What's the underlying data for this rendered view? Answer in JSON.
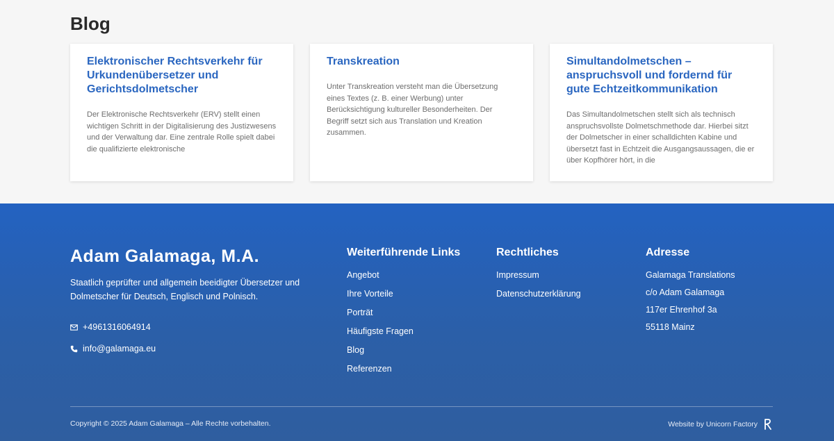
{
  "blog": {
    "heading": "Blog",
    "cards": [
      {
        "title": "Elektronischer Rechtsverkehr für Urkundenübersetzer und Gerichtsdolmetscher",
        "excerpt": "Der Elektronische Rechtsverkehr (ERV) stellt einen wichtigen Schritt in der Digitalisierung des Justizwesens und der Verwaltung dar. Eine zentrale Rolle spielt dabei die qualifizierte elektronische"
      },
      {
        "title": "Transkreation",
        "excerpt": "Unter Transkreation versteht man die Übersetzung eines Textes (z. B. einer Werbung) unter Berücksichtigung kultureller Besonderheiten. Der Begriff setzt sich aus Translation und Kreation zusammen."
      },
      {
        "title": "Simultandolmetschen – anspruchsvoll und fordernd für gute Echtzeitkommunikation",
        "excerpt": "Das Simultandolmetschen stellt sich als technisch anspruchsvollste Dolmetschmethode dar. Hierbei sitzt der Dolmetscher in einer schalldichten Kabine und übersetzt fast in Echtzeit die Ausgangsaussagen, die er über Kopfhörer hört, in die"
      }
    ]
  },
  "footer": {
    "brand": "Adam Galamaga, M.A.",
    "tagline": "Staatlich geprüfter und allgemein beeidigter Übersetzer und Dolmetscher für Deutsch, Englisch und Polnisch.",
    "phone": "+4961316064914",
    "email": "info@galamaga.eu",
    "links_title": "Weiterführende Links",
    "links": [
      "Angebot",
      "Ihre Vorteile",
      "Porträt",
      "Häufigste Fragen",
      "Blog",
      "Referenzen"
    ],
    "legal_title": "Rechtliches",
    "legal": [
      "Impressum",
      "Datenschutzerklärung"
    ],
    "address_title": "Adresse",
    "address": [
      "Galamaga Translations",
      "c/o Adam Galamaga",
      "117er Ehrenhof 3a",
      "55118 Mainz"
    ],
    "copyright": "Copyright © 2025 Adam Galamaga – Alle Rechte vorbehalten.",
    "credit": "Website by Unicorn Factory"
  }
}
